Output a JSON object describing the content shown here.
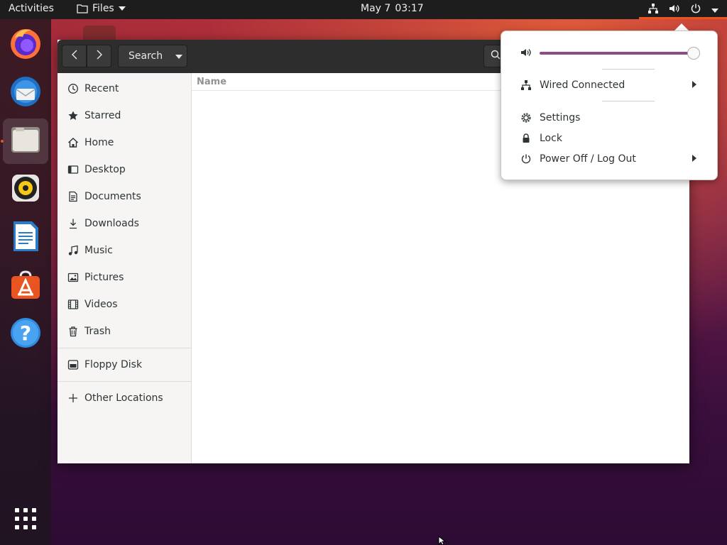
{
  "topbar": {
    "activities": "Activities",
    "app_name": "Files",
    "date": "May 7",
    "time": "03:17",
    "status_icons": [
      "network-wired-icon",
      "volume-icon",
      "power-icon",
      "chevron-down-icon"
    ]
  },
  "dock": {
    "apps": [
      {
        "name": "Firefox",
        "icon": "firefox-icon"
      },
      {
        "name": "Thunderbird",
        "icon": "thunderbird-icon"
      },
      {
        "name": "Files",
        "icon": "files-icon",
        "running": true
      },
      {
        "name": "Rhythmbox",
        "icon": "rhythmbox-icon"
      },
      {
        "name": "LibreOffice Writer",
        "icon": "writer-icon"
      },
      {
        "name": "Ubuntu Software",
        "icon": "software-icon"
      },
      {
        "name": "Help",
        "icon": "help-icon"
      }
    ],
    "show_apps_icon": "app-grid-icon"
  },
  "files": {
    "path_label": "Search",
    "sidebar": {
      "places": [
        {
          "label": "Recent",
          "icon": "clock-icon"
        },
        {
          "label": "Starred",
          "icon": "star-icon"
        },
        {
          "label": "Home",
          "icon": "home-icon"
        },
        {
          "label": "Desktop",
          "icon": "desktop-icon"
        },
        {
          "label": "Documents",
          "icon": "document-icon"
        },
        {
          "label": "Downloads",
          "icon": "download-icon"
        },
        {
          "label": "Music",
          "icon": "music-icon"
        },
        {
          "label": "Pictures",
          "icon": "picture-icon"
        },
        {
          "label": "Videos",
          "icon": "video-icon"
        },
        {
          "label": "Trash",
          "icon": "trash-icon"
        }
      ],
      "devices": [
        {
          "label": "Floppy Disk",
          "icon": "floppy-icon"
        }
      ],
      "other": {
        "label": "Other Locations",
        "icon": "plus-icon"
      }
    },
    "list": {
      "columns": [
        "Name"
      ],
      "rows": []
    }
  },
  "system_menu": {
    "volume_level": 0.96,
    "items": [
      {
        "label": "Wired Connected",
        "icon": "network-wired-icon",
        "submenu": true
      },
      {
        "label": "Settings",
        "icon": "gear-icon",
        "submenu": false
      },
      {
        "label": "Lock",
        "icon": "lock-icon",
        "submenu": false
      },
      {
        "label": "Power Off / Log Out",
        "icon": "power-icon",
        "submenu": true
      }
    ]
  },
  "colors": {
    "accent": "#e95420",
    "slider": "#8e4d86",
    "topbar": "#1d1d1d",
    "headerbar": "#2d2d2d"
  }
}
